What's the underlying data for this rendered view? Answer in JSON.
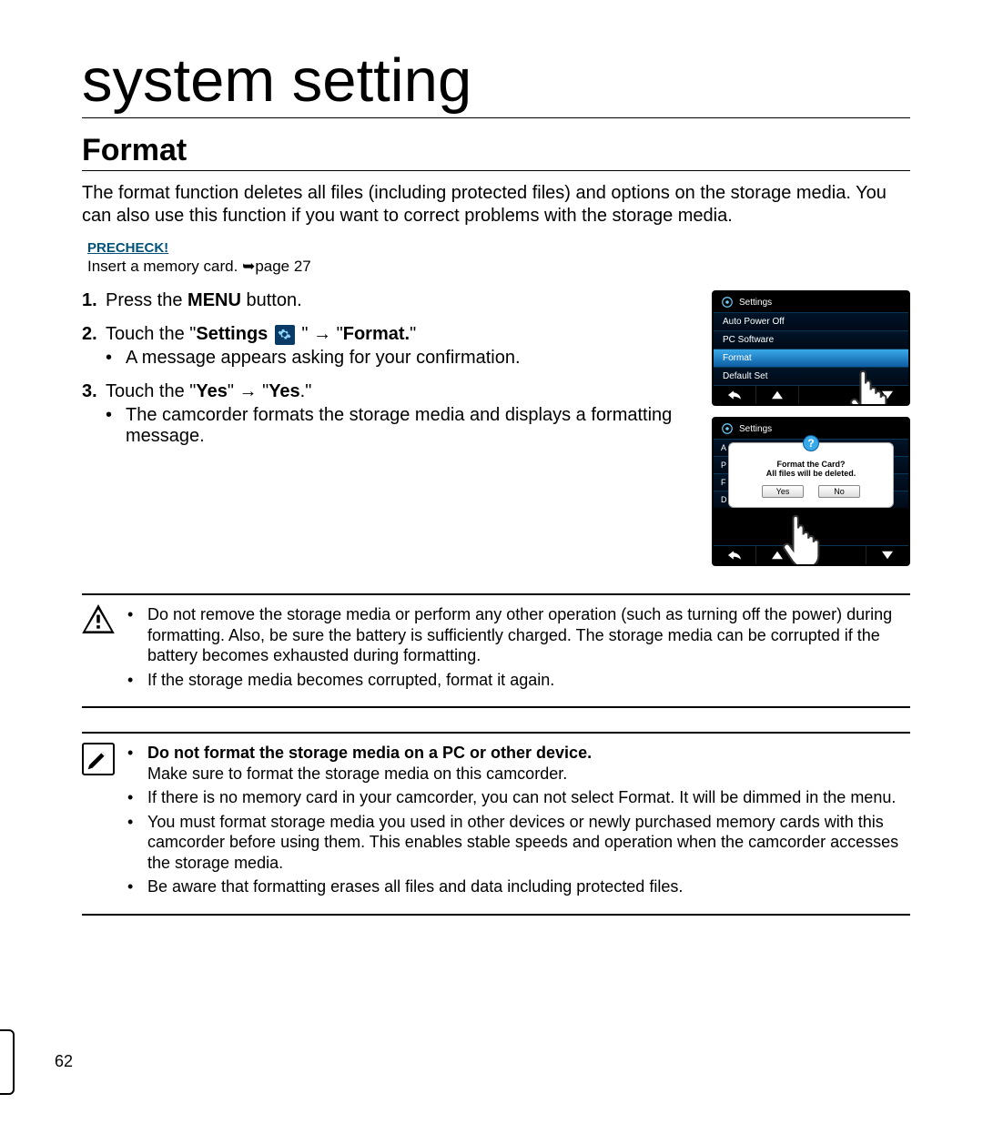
{
  "chapter": "system setting",
  "section": "Format",
  "intro": "The format function deletes all files (including protected files) and options on the storage media. You can also use this function if you want to correct problems with the storage media.",
  "precheck_label": "PRECHECK!",
  "precheck_text_a": "Insert a memory card. ",
  "precheck_text_b": "page 27",
  "step1_a": "Press the ",
  "step1_b": "MENU",
  "step1_c": " button.",
  "step2_a": "Touch the \"",
  "step2_b": "Settings",
  "step2_c": " \" → \"",
  "step2_d": "Format.",
  "step2_e": "\"",
  "step2_sub": "A message appears asking for your confirmation.",
  "step3_a": "Touch the \"",
  "step3_b": "Yes",
  "step3_c": "\" → \"",
  "step3_d": "Yes",
  "step3_e": ".\"",
  "step3_sub": "The camcorder formats the storage media and displays a formatting message.",
  "lcd1": {
    "title": "Settings",
    "items": [
      "Auto Power Off",
      "PC Software",
      "Format",
      "Default Set"
    ]
  },
  "lcd2": {
    "title": "Settings",
    "bg_items": [
      "A",
      "P",
      "F",
      "D"
    ],
    "dialog_line1": "Format the Card?",
    "dialog_line2": "All files will be deleted.",
    "yes": "Yes",
    "no": "No"
  },
  "warn1": "Do not remove the storage media or perform any other operation (such as turning off the power) during formatting. Also, be sure the battery is sufficiently charged. The storage media can be corrupted if the battery becomes exhausted during formatting.",
  "warn2": "If the storage media becomes corrupted, format it again.",
  "note1_bold": "Do not format the storage media on a PC or other device.",
  "note1_rest": "Make sure to format the storage media on this camcorder.",
  "note2": "If there is no memory card in your camcorder, you can not select Format. It will be dimmed in the menu.",
  "note3": "You must format storage media you used in other devices or newly purchased memory cards with this camcorder before using them. This enables stable speeds and operation when the camcorder accesses the storage media.",
  "note4": "Be aware that formatting erases all files and data including protected files.",
  "page_number": "62"
}
